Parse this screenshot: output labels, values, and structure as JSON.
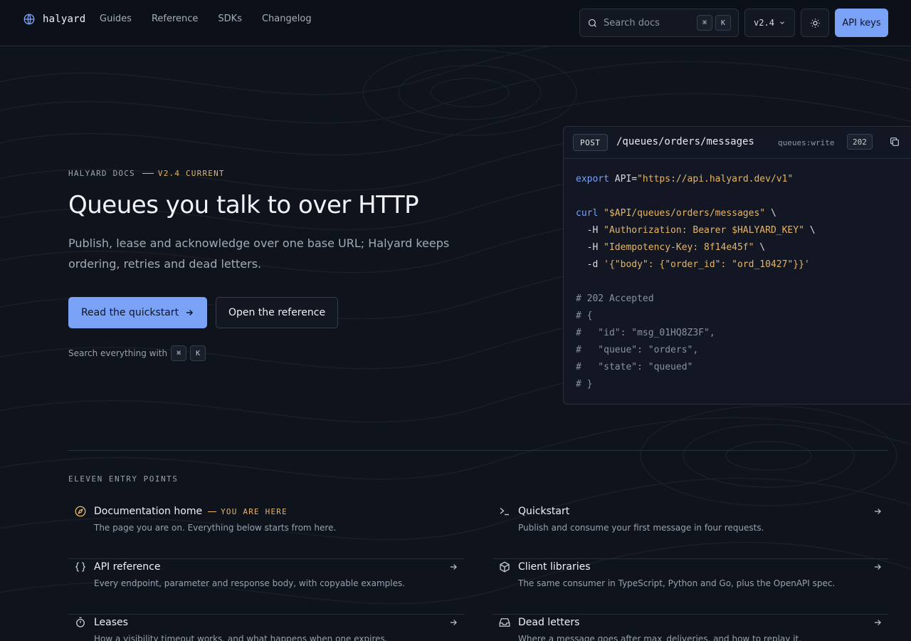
{
  "brand": {
    "name": "halyard"
  },
  "nav": [
    {
      "label": "Guides"
    },
    {
      "label": "Reference"
    },
    {
      "label": "SDKs"
    },
    {
      "label": "Changelog"
    }
  ],
  "search": {
    "placeholder": "Search docs",
    "shortcut": [
      "⌘",
      "K"
    ]
  },
  "version": {
    "selected": "v2.4"
  },
  "header": {
    "api_keys_label": "API keys"
  },
  "hero": {
    "eyebrow": "HALYARD DOCS",
    "eyebrow_accent": "V2.4 CURRENT",
    "title": "Queues you talk to over HTTP",
    "subtitle": "Publish, lease and acknowledge over one base URL; Halyard keeps ordering, retries and dead letters.",
    "primary_cta": "Read the quickstart",
    "secondary_cta": "Open the reference",
    "hint": "Search everything with",
    "hint_keys": [
      "⌘",
      "K"
    ]
  },
  "code_panel": {
    "method": "POST",
    "path": "/queues/orders/messages",
    "scope": "queues:write",
    "status": "202",
    "lines": {
      "export_kw": "export",
      "export_var": " API=",
      "export_val": "\"https://api.halyard.dev/v1\"",
      "curl_kw": "curl",
      "curl_url": "\"$API/queues/orders/messages\"",
      "curl_tail": " \\",
      "h1_flag": "  -H ",
      "h1_val": "\"Authorization: Bearer $HALYARD_KEY\"",
      "h1_tail": " \\",
      "h2_flag": "  -H ",
      "h2_val": "\"Idempotency-Key: 8f14e45f\"",
      "h2_tail": " \\",
      "d_flag": "  -d ",
      "d_val": "'{\"body\": {\"order_id\": \"ord_10427\"}}'",
      "r1": "# 202 Accepted",
      "r2": "# {",
      "r3": "#   \"id\": \"msg_01HQ8Z3F\",",
      "r4": "#   \"queue\": \"orders\",",
      "r5": "#   \"state\": \"queued\"",
      "r6": "# }"
    }
  },
  "entry_points": {
    "label": "ELEVEN ENTRY POINTS",
    "you_are_here": "YOU ARE HERE",
    "items": [
      {
        "icon": "compass-icon",
        "title": "Documentation home",
        "desc": "The page you are on. Everything below starts from here."
      },
      {
        "icon": "terminal-icon",
        "title": "Quickstart",
        "desc": "Publish and consume your first message in four requests."
      },
      {
        "icon": "braces-icon",
        "title": "API reference",
        "desc": "Every endpoint, parameter and response body, with copyable examples."
      },
      {
        "icon": "package-icon",
        "title": "Client libraries",
        "desc": "The same consumer in TypeScript, Python and Go, plus the OpenAPI spec."
      },
      {
        "icon": "timer-icon",
        "title": "Leases",
        "desc": "How a visibility timeout works, and what happens when one expires."
      },
      {
        "icon": "inbox-icon",
        "title": "Dead letters",
        "desc": "Where a message goes after max_deliveries, and how to replay it."
      }
    ]
  },
  "colors": {
    "accent": "#7aa2f7",
    "highlight": "#e5b567",
    "background": "#0f131c"
  }
}
